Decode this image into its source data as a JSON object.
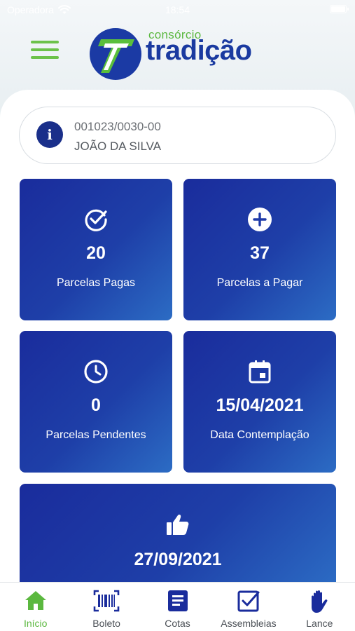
{
  "status_bar": {
    "carrier": "Operadora",
    "time": "18:54"
  },
  "header": {
    "logo_subtitle": "consórcio",
    "logo_name": "tradição",
    "menu_icon": "hamburger-icon"
  },
  "account": {
    "code": "001023/0030-00",
    "holder": "JOÃO DA SILVA",
    "icon": "info-icon"
  },
  "cards": [
    {
      "icon": "check-circle-icon",
      "value": "20",
      "label": "Parcelas Pagas"
    },
    {
      "icon": "plus-circle-icon",
      "value": "37",
      "label": "Parcelas a Pagar"
    },
    {
      "icon": "clock-icon",
      "value": "0",
      "label": "Parcelas Pendentes"
    },
    {
      "icon": "calendar-icon",
      "value": "15/04/2021",
      "label": "Data Contemplação"
    },
    {
      "icon": "thumbs-up-icon",
      "value": "27/09/2021",
      "label": ""
    }
  ],
  "tabs": [
    {
      "label": "Início",
      "icon": "home-icon",
      "active": true
    },
    {
      "label": "Boleto",
      "icon": "barcode-icon",
      "active": false
    },
    {
      "label": "Cotas",
      "icon": "document-icon",
      "active": false
    },
    {
      "label": "Assembleias",
      "icon": "checkbox-icon",
      "active": false
    },
    {
      "label": "Lance",
      "icon": "hand-icon",
      "active": false
    }
  ],
  "colors": {
    "brand_blue": "#1a2c9c",
    "brand_green": "#5bb83f",
    "card_gradient_end": "#2c6cc4"
  }
}
